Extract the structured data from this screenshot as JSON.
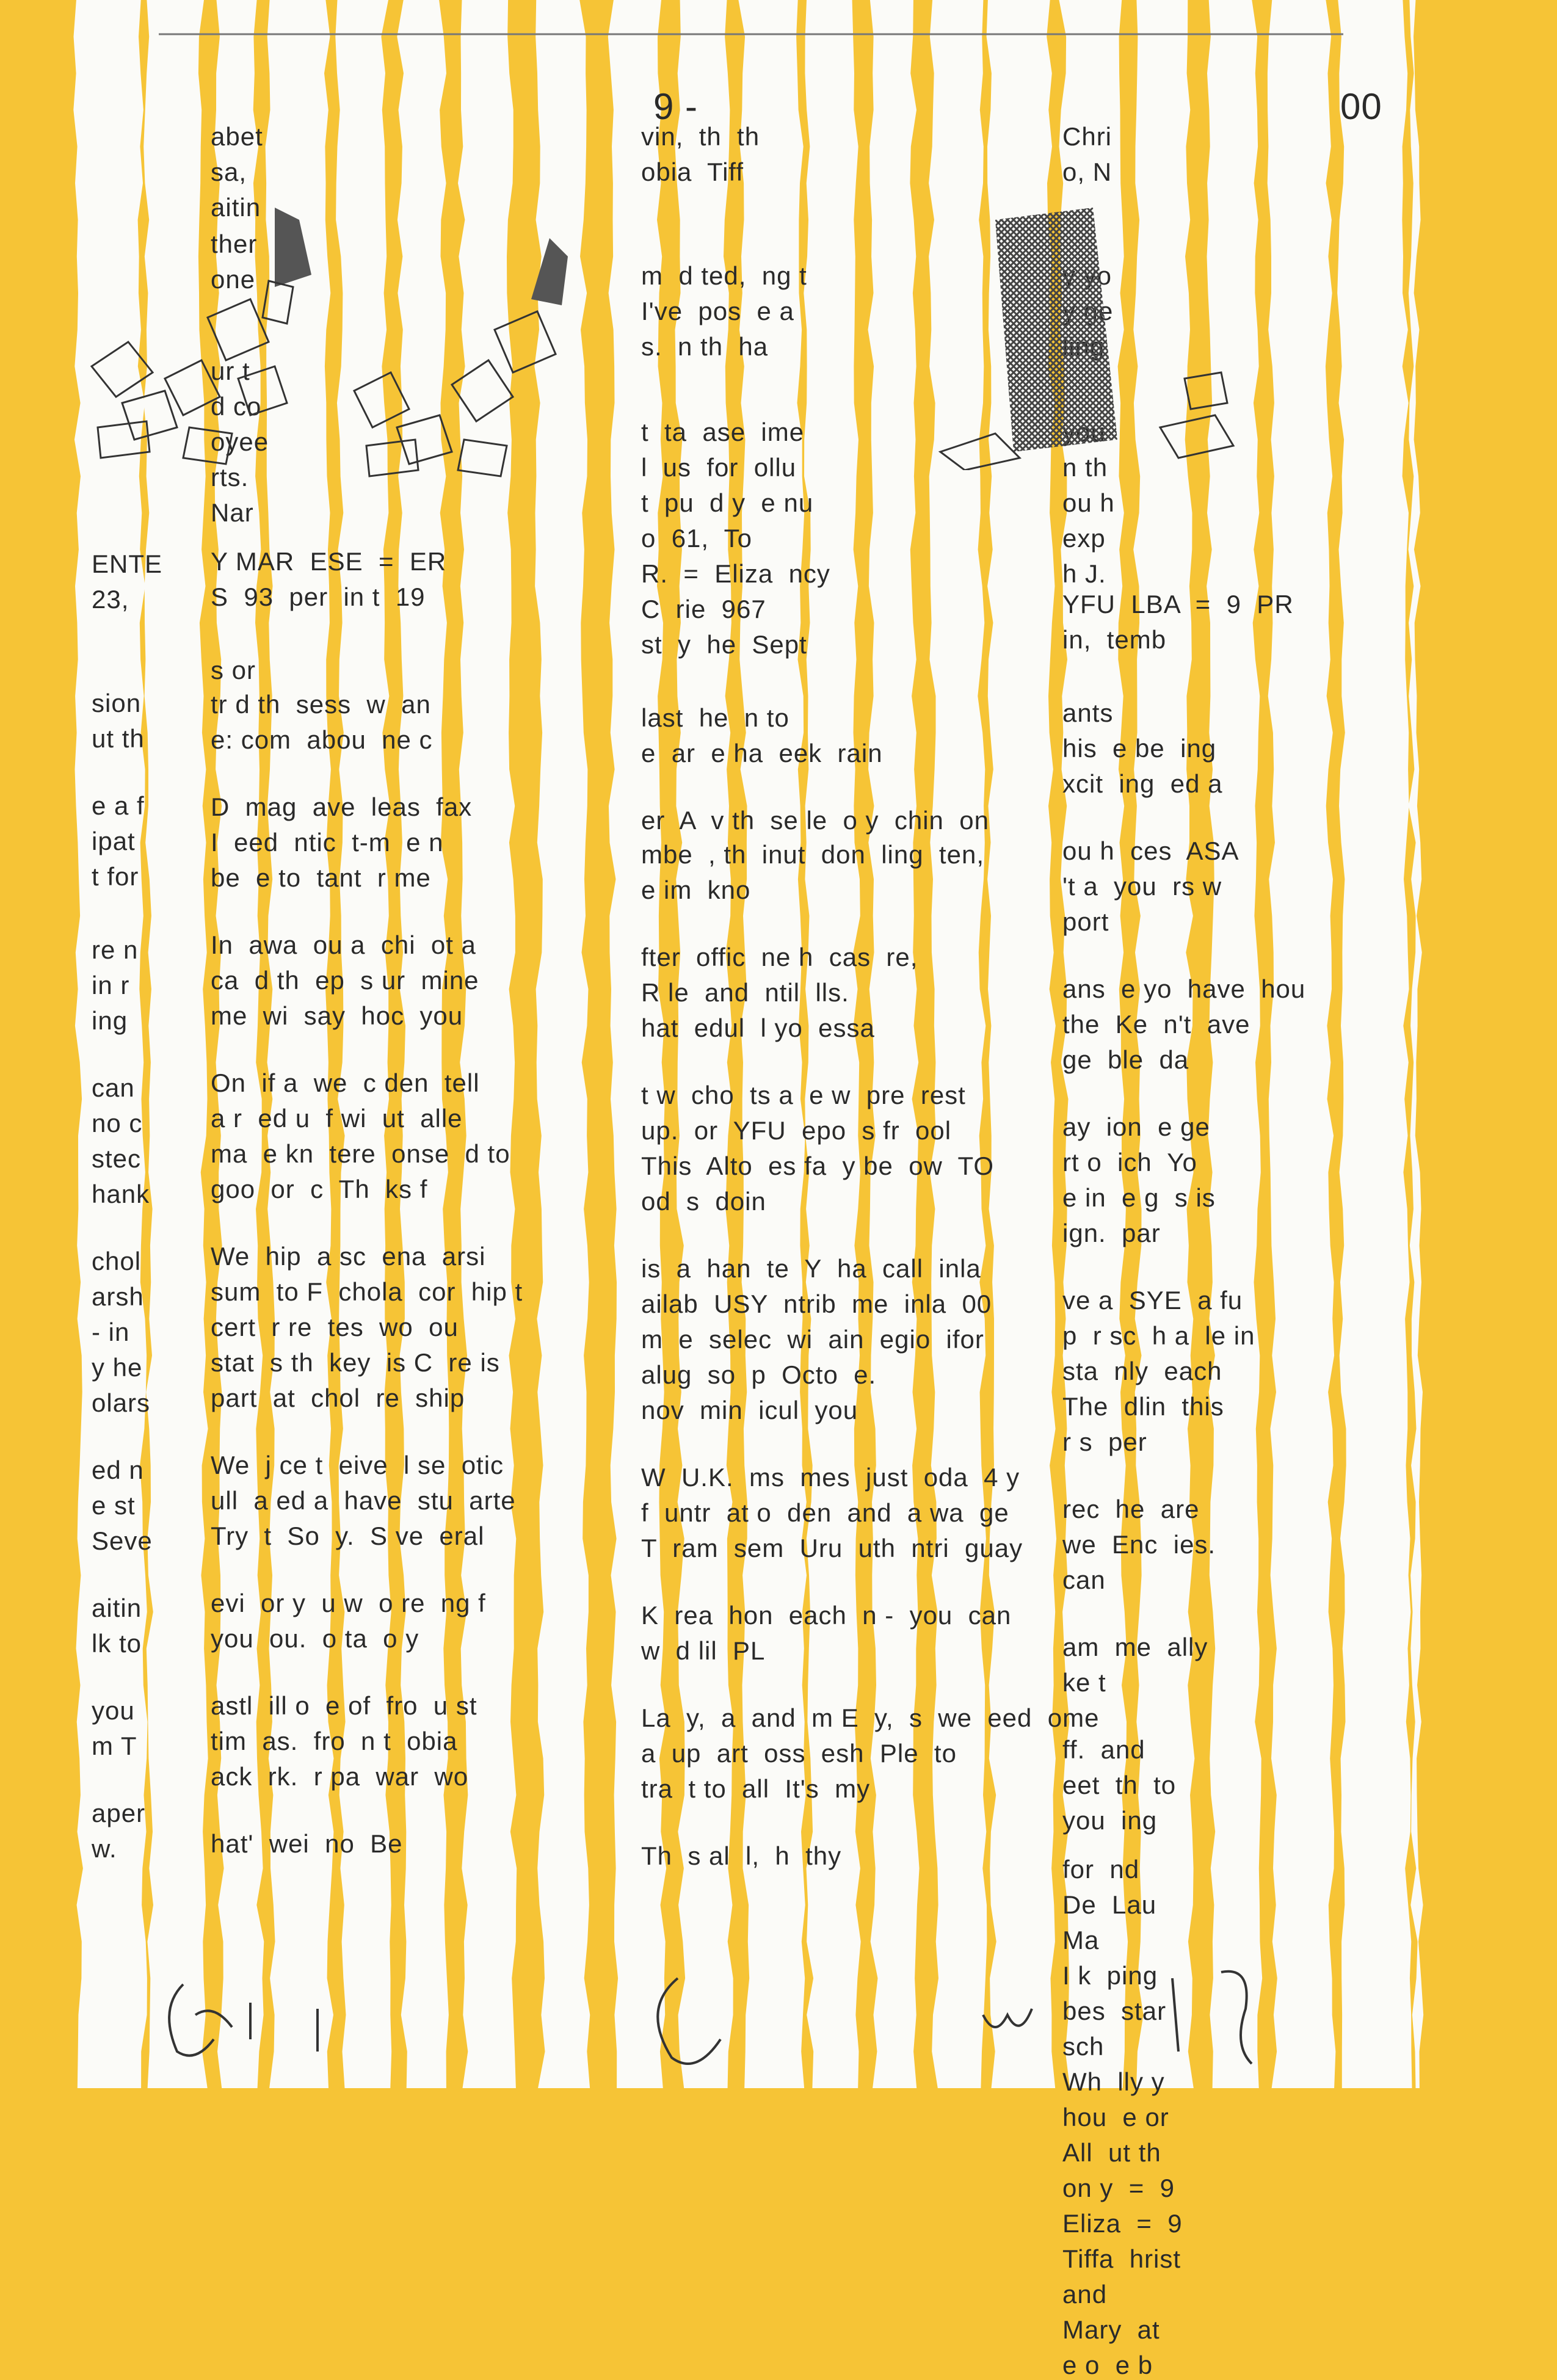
{
  "document": {
    "page_background": "#f6c436",
    "paper_color": "#fbfbf8",
    "ink_color": "#2a2a2a",
    "header_marks": [
      "9 -",
      "00"
    ],
    "left_fragment_lines": [
      "ENTE",
      "23,",
      "sion",
      "ut th",
      "e a f",
      "ipat",
      "t for",
      "re n",
      "in r",
      "ing",
      "can",
      "no c",
      "stec",
      "hank",
      "chol",
      "arsh",
      "- in",
      "y he",
      "olars",
      "ed n",
      "e st",
      "Seve",
      "aitin",
      "lk to",
      "you",
      "m T",
      "aper",
      "w."
    ],
    "middle_fragment_lines": [
      "abet",
      "sa,",
      "aitin",
      "ther",
      "one",
      "ur t",
      "d co",
      "oyee",
      "rts.",
      "Nar",
      "Y MAR  ESE  =  ER",
      "S  93  per  in t  19",
      "s or",
      "tr d th  sess  w  an",
      "e: com  abou  ne c",
      "D  mag  ave  leas  fax",
      "I  eed  ntic  t-m  e n",
      "be  e to  tant  r me",
      "In  awa  ou a  chi  ot a",
      "ca  d th  ep  s ur  mine",
      "me  wi  say  hoc  you",
      "On  if a  we  c den  tell",
      "a r  ed u  f wi  ut  alle",
      "ma  e kn  tere  onse  d to",
      "goo  or  c  Th  ks f",
      "We  hip  a sc  ena  arsi",
      "sum  to F  chola  cor  hip t",
      "cert  r re  tes  wo  ou",
      "stat  s th  key  is C  re is",
      "part  at  chol  re  ship",
      "We  j ce t  eive  l se  otic",
      "ull  a ed a  have  stu  arte",
      "Try  t  So  y.  S ve  eral",
      "evi  or y  u w  o re  ng f",
      "you  ou.  o ta  o y",
      "astl  ill o  e of  fro  u st",
      "tim  as.  fro  n t  obia",
      "ack  rk.  r pa  war  wo",
      "hat'  wei  no  Be"
    ],
    "right_fragment_lines": [
      "vin,  th  th",
      "obia  Tiff",
      "m  d ted,  ng t",
      "I've  pos  e a",
      "s.  n th  ha",
      "t  ta  ase  ime",
      "l  us  for  ollu",
      "t  pu  d y  e nu",
      "o  61,  To",
      "R.  =  Eliza  ncy",
      "C  rie  967",
      "st  y  he  Sept",
      "last  he  n to",
      "e  ar  e ha  eek  rain",
      "er  A  v th  se le  o y  chin  on",
      "mbe  , th  inut  don  ling  ten,",
      "e im  kno",
      "fter  offic  ne h  cas  re,",
      "R le  and  ntil  lls.",
      "hat  edul  l yo  essa",
      "t w  cho  ts a  e w  pre  rest",
      "up.  or  YFU  epo  s fr  ool",
      "This  Alto  es fa  y be  ow  TO",
      "od  s  doin",
      "is  a  han  te  Y  ha  call  inla",
      "ailab  USY  ntrib  me  inla  00",
      "m  e  selec  wi  ain  egio  ifor",
      "alug  so  p  Octo  e.",
      "nov  min  icul  you",
      "W  U.K.  ms  mes  just  oda  4 y",
      "f  untr  at o  den  and  a wa  ge",
      "T  ram  sem  Uru  uth  ntri  guay",
      "K  rea  hon  each  n -  you  can",
      "w  d lil  PL",
      "La  y,  a  and  m E  y,  s  we  eed  ome",
      "a  up  art  oss  esh  Ple  to",
      "tra  t to  all  It's  my",
      "Th  s al  l,  h  thy"
    ],
    "far_right_fragment_lines": [
      "Chri",
      "o, N",
      "y yo",
      "y ge",
      "ling",
      "you",
      "n th",
      "ou h",
      "exp",
      "h J.",
      "YFU  LBA  =  9  PR",
      "in,  temb",
      "ants",
      "his  e be  ing",
      "xcit  ing  ed a",
      "ou h  ces  ASA",
      "'t a  you  rs w",
      "port",
      "ans  e yo  have  hou",
      "the  Ke  n't  ave",
      "ge  ble  da",
      "ay  ion  e ge",
      "rt o  ich  Yo",
      "e in  e g  s is",
      "ign.  par",
      "ve a  SYE  a fu",
      "p  r sc  h a  le in",
      "sta  nly  each",
      "The  dlin  this",
      "r s  per",
      "rec  he  are",
      "we  Enc  ies.",
      "can",
      "am  me  ally",
      "ke t",
      "ff.  and",
      "eet  th  to",
      "you  ing",
      "for  nd",
      "De  Lau",
      "Ma",
      "I k  ping",
      "bes  star",
      "sch",
      "Wh  lly y",
      "hou  e or",
      "All  ut th",
      "on y  =  9",
      "Eliza  =  9",
      "Tiffa  hrist",
      "and",
      "Mary  at",
      "e o  e b"
    ]
  }
}
